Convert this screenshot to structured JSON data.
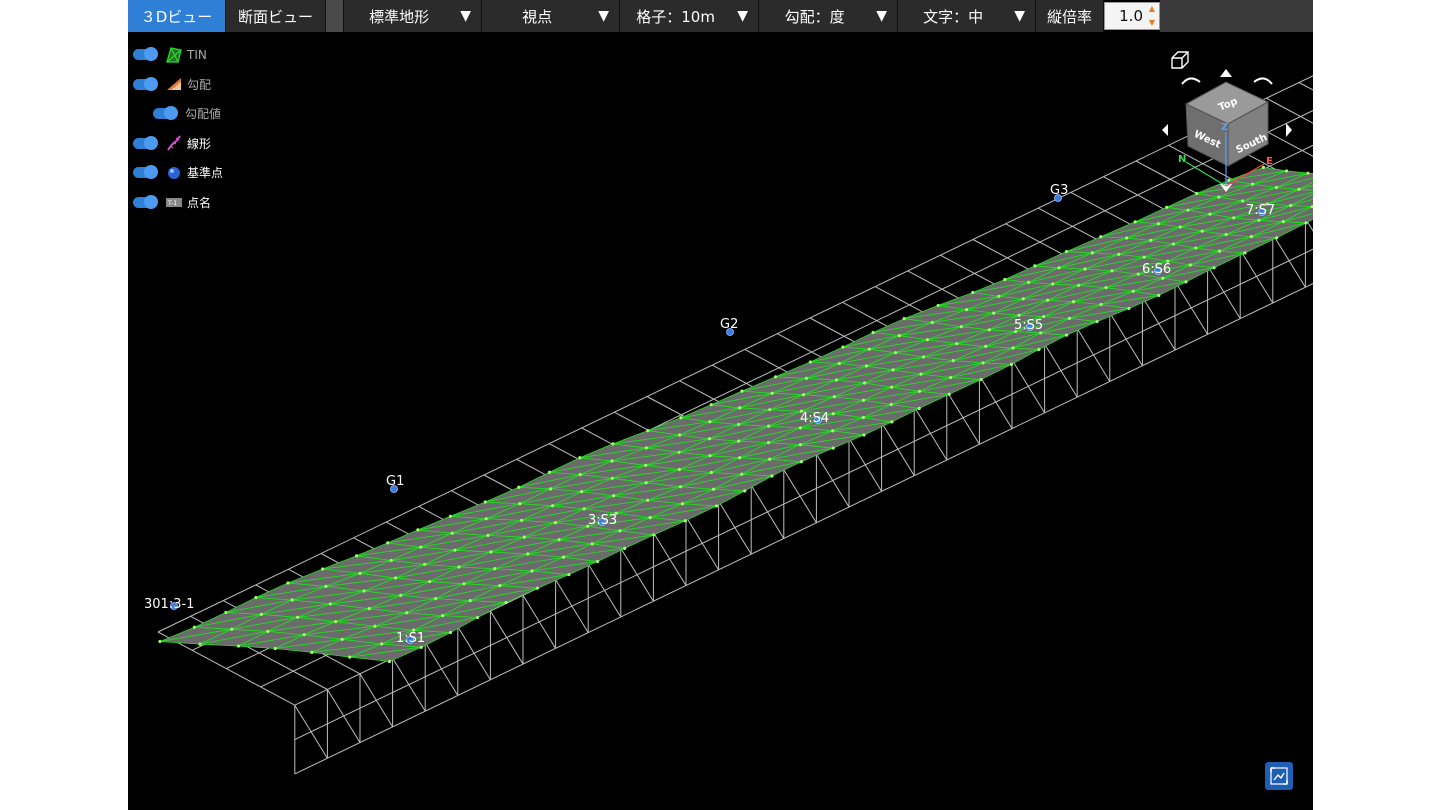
{
  "toolbar": {
    "tab_3d": "３Dビュー",
    "tab_section": "断面ビュー",
    "terrain": "標準地形",
    "viewpoint": "視点",
    "grid": "格子：10m",
    "slope": "勾配：度",
    "text_size": "文字：中",
    "vertical_scale_label": "縦倍率",
    "vertical_scale_value": "1.0",
    "dropdown_arrow": "▼"
  },
  "layers": [
    {
      "label": "TIN",
      "icon": "tin-icon",
      "on": true
    },
    {
      "label": "勾配",
      "icon": "slope-icon",
      "on": true
    },
    {
      "label": "勾配値",
      "icon": "",
      "on": true
    },
    {
      "label": "線形",
      "icon": "alignment-icon",
      "on": true
    },
    {
      "label": "基準点",
      "icon": "control-point-icon",
      "on": true
    },
    {
      "label": "点名",
      "icon": "point-name-icon",
      "on": true
    }
  ],
  "point_labels": [
    "301:3-1",
    "1:S1",
    "G1",
    "3:S3",
    "4:S4",
    "G2",
    "5:S5",
    "6:S6",
    "G3",
    "7:S7"
  ],
  "view_cube": {
    "top": "Top",
    "west": "West",
    "south": "South",
    "axis_n": "N",
    "axis_e": "E",
    "axis_z": "Z"
  },
  "colors": {
    "tin_edge": "#22dd22",
    "tin_fill": "#6b6b6b",
    "grid": "#bfbfbf",
    "point": "#3b7de0",
    "accent": "#2f7fd6"
  }
}
